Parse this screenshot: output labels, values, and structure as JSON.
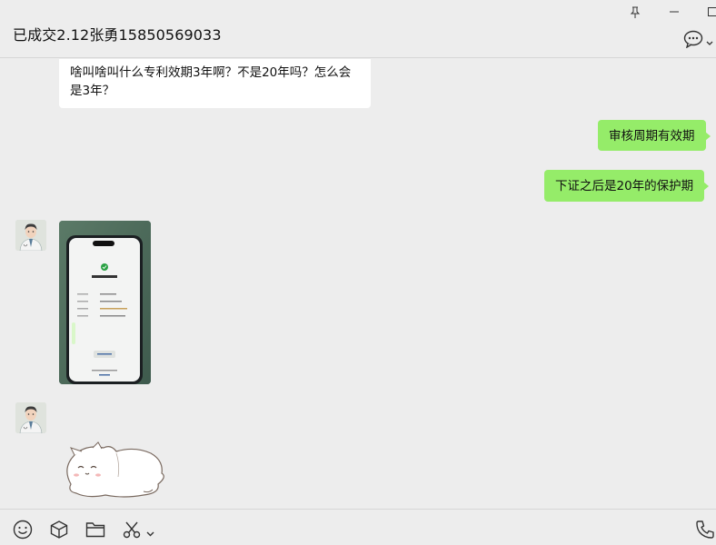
{
  "window": {
    "title": "已成交2.12张勇15850569033",
    "buttons": [
      "pin-icon",
      "minimize-icon",
      "maximize-icon"
    ]
  },
  "header": {
    "more_icon": "chat-bubble-icon",
    "dropdown_icon": "chevron-down-icon"
  },
  "messages": [
    {
      "type": "text",
      "direction": "received",
      "text": "啥叫啥叫什么专利效期3年啊？不是20年吗？怎么会\n是3年？"
    },
    {
      "type": "text",
      "direction": "sent",
      "text": "审核周期有效期"
    },
    {
      "type": "text",
      "direction": "sent",
      "text": "下证之后是20年的保护期"
    },
    {
      "type": "image",
      "direction": "received",
      "avatar": "doctor-avatar",
      "content": "phone-payment-screenshot"
    },
    {
      "type": "sticker",
      "direction": "received",
      "avatar": "doctor-avatar",
      "content": "cat-sticker"
    }
  ],
  "toolbar": {
    "icons": [
      "emoji-icon",
      "sticker-box-icon",
      "folder-icon",
      "scissors-icon",
      "chevron-down-icon",
      "phone-icon"
    ]
  },
  "colors": {
    "background": "#ededed",
    "sent_bubble": "#95ec69",
    "received_bubble": "#ffffff"
  }
}
